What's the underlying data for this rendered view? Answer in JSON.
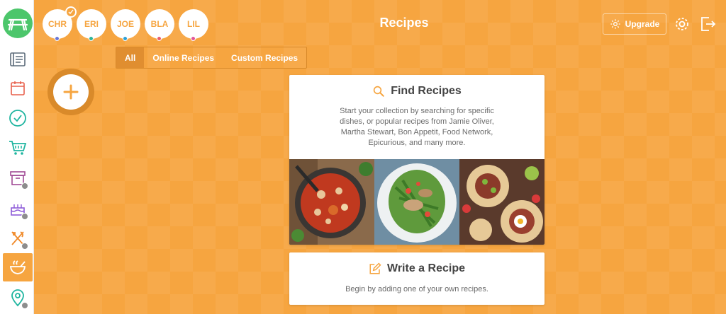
{
  "header": {
    "title": "Recipes",
    "upgrade_label": "Upgrade"
  },
  "members": [
    {
      "initials": "CHR",
      "dot_color": "#6b78d6",
      "selected": true
    },
    {
      "initials": "ERI",
      "dot_color": "#2bb59a",
      "selected": false
    },
    {
      "initials": "JOE",
      "dot_color": "#2aa0d8",
      "selected": false
    },
    {
      "initials": "BLA",
      "dot_color": "#e85d6a",
      "selected": false
    },
    {
      "initials": "LIL",
      "dot_color": "#e2579b",
      "selected": false
    }
  ],
  "filter_tabs": [
    {
      "label": "All",
      "active": true
    },
    {
      "label": "Online Recipes",
      "active": false
    },
    {
      "label": "Custom Recipes",
      "active": false
    }
  ],
  "sidebar": {
    "items": [
      {
        "icon": "menu-list-icon",
        "color": "#5c6b7a",
        "locked": false
      },
      {
        "icon": "calendar-icon",
        "color": "#e8604c",
        "locked": false
      },
      {
        "icon": "checklist-icon",
        "color": "#1fb5a0",
        "locked": false
      },
      {
        "icon": "shopping-cart-icon",
        "color": "#1fb5a0",
        "locked": false
      },
      {
        "icon": "archive-box-icon",
        "color": "#a14b96",
        "locked": true
      },
      {
        "icon": "birthday-cake-icon",
        "color": "#8e5bd8",
        "locked": true
      },
      {
        "icon": "utensils-icon",
        "color": "#f08a2a",
        "locked": true
      },
      {
        "icon": "mortar-pestle-icon",
        "color": "#ffffff",
        "locked": false,
        "active": true
      },
      {
        "icon": "location-pin-icon",
        "color": "#1fb5a0",
        "locked": true
      }
    ]
  },
  "find_card": {
    "title": "Find Recipes",
    "description": "Start your collection by searching for specific dishes, or popular recipes from Jamie Oliver, Martha Stewart, Bon Appetit, Food Network, Epicurious, and many more."
  },
  "write_card": {
    "title": "Write a Recipe",
    "description": "Begin by adding one of your own recipes."
  },
  "colors": {
    "accent": "#f6a540",
    "brand_green": "#4cc66b"
  }
}
